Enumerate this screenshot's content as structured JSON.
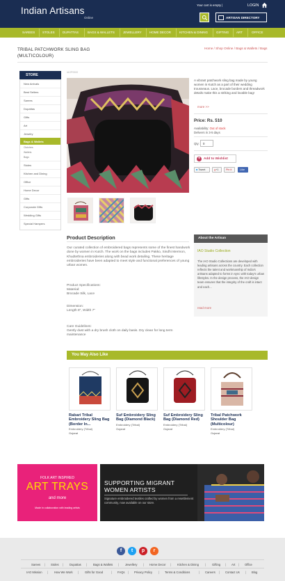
{
  "header": {
    "logo_main": "Indian Artisans",
    "logo_sub": "Online",
    "cart_text": "Your cart is empty |",
    "login": "LOGIN",
    "directory_button": "ARTISAN DIRECTORY"
  },
  "nav": {
    "items": [
      "SAREES",
      "STOLES",
      "DUPATTAS",
      "BAGS & WALLETS",
      "JEWELLERY",
      "HOME DECOR",
      "KITCHEN & DINING",
      "GIFTING",
      "ART",
      "OFFICE"
    ]
  },
  "page": {
    "title_line1": "TRIBAL PATCHWORK SLING BAG",
    "title_line2": "(MULTICOLOUR)",
    "breadcrumb": "Home / Shop Online / Bags & Wallets / Bags"
  },
  "sidebar": {
    "heading": "STORE",
    "items": [
      "New Arrivals",
      "Best Sellers",
      "Sarees",
      "Dupattas",
      "Gifts",
      "Art",
      "Jewelry"
    ],
    "active": "Bags & Wallets",
    "subitems": [
      "Clutches",
      "Wallets",
      "Bags"
    ],
    "items_after": [
      "Stoles",
      "Kitchen and Dining",
      "Office",
      "Home Decor",
      "Gifts",
      "Corporate Gifts",
      "Wedding Gifts",
      "Special Hampers"
    ]
  },
  "product": {
    "sku": "IAOP0000",
    "short_description": "A vibrant patchwork sling bag made by young women in Kutch as a part of their wedding trousseaus. Lace, brocade borders and threadwork details make this a striking and lovable bag!",
    "more": "more >>",
    "price": "Price: Rs. 510",
    "availability_label": "Availability:",
    "availability_value": "Out of stock",
    "delivery": "Delivers in 3-5 days",
    "qty_label": "Qty:",
    "qty_value": "0",
    "wishlist": "Add to Wishlist",
    "social": [
      "Tweet",
      "+1",
      "Pin it",
      "Like"
    ]
  },
  "description": {
    "heading": "Product Description",
    "paragraph": "Our curated collection of embroidered bags represents some of the finest handwork done by women in Kutch. The work on the bags includes Pakko, Sindhi Mermon, Khudtethna embroideries along with bead work detailing. These heritage embroideries have been adapted to meet style and functional preferences of young urban women.",
    "specs_title": "Product Specifications:",
    "material_label": "Material:",
    "material_value": "Brocade Silk, Lace",
    "dimension_label": "Dimension:",
    "dimension_value": "Length 8\", Width 7\"",
    "care_title": "Care Guidelines:",
    "care_text": "Gently dust with a dry brush cloth on daily basis. Dry clean for long term maintenance"
  },
  "artisan": {
    "heading": "About the Artisan",
    "logo_text": "IAO",
    "name": "IAO Studio Collection",
    "text": "The IAO Studio Collections are developed with leading artisans across the country. Each collection reflects the talent and workmanship of India's artisans adapted to forms in sync with today's urban lifestyles. In the design process, the IAO design team ensures that the integrity of the craft is intact and each...",
    "read_more": "read more"
  },
  "also_like": {
    "heading": "You May Also Like",
    "items": [
      {
        "name": "Rabari Tribal Embroidery Sling Bag (Border In...",
        "cat": "Embroidery (Tribal)",
        "region": "Gujarat"
      },
      {
        "name": "Suf Embroidery Sling Bag (Diamond Black)",
        "cat": "Embroidery (Tribal)",
        "region": "Gujarat"
      },
      {
        "name": "Suf Embroidery Sling Bag (Diamond Red)",
        "cat": "Embroidery (Tribal)",
        "region": "Gujarat"
      },
      {
        "name": "Tribal Patchwork Shoulder Bag (Multicolour)",
        "cat": "Embroidery (Tribal)",
        "region": "Gujarat"
      }
    ]
  },
  "banners": {
    "left_kicker": "FOLK ART INSPIRED",
    "left_title": "ART TRAYS",
    "left_more": "and more",
    "left_foot": "Made in collaboration with leading artists",
    "right_title_line1": "SUPPORTING MIGRANT",
    "right_title_line2": "WOMEN ARTISTS",
    "right_text": "Signature embroidered textiles crafted by women from a resettlement community, now available on our store."
  },
  "footer": {
    "social_icons": [
      "facebook-icon",
      "twitter-icon",
      "pinterest-icon",
      "rss-icon"
    ],
    "row1": [
      "Sarees",
      "Stoles",
      "Dupattas",
      "Bags & Wallets",
      "Jewellery",
      "Home Decor",
      "Kitchen & Dining",
      "Gifting",
      "Art",
      "Office"
    ],
    "row2": [
      "IAO Mission",
      "How We Work",
      "Gifts for Good",
      "FAQs",
      "Privacy Policy",
      "Terms & Conditions",
      "Careers",
      "Contact Us",
      "Blog"
    ]
  },
  "colors": {
    "navy": "#1a2d52",
    "lime": "#a8b92a",
    "pink": "#e9227a",
    "link": "#cc5555"
  }
}
